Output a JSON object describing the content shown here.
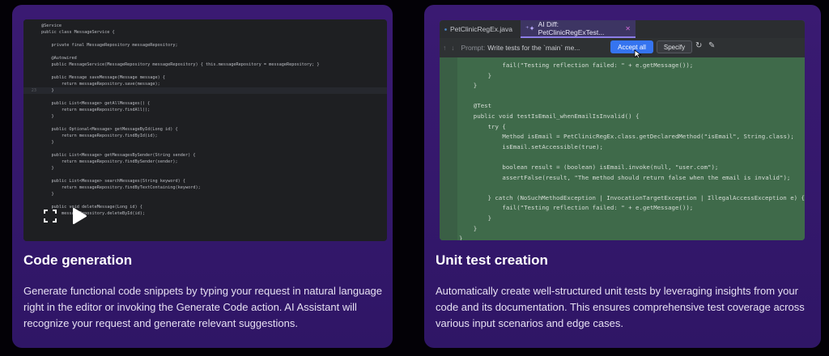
{
  "colors": {
    "background": "#030106",
    "card": "#351a6e",
    "accent": "#3574f0"
  },
  "left_card": {
    "title": "Code generation",
    "description": "Generate functional code snippets by typing your request in natural language right in the editor or invoking the Generate Code action. AI Assistant will recognize your request and generate relevant suggestions.",
    "code": [
      {
        "n": "",
        "t": "@Service"
      },
      {
        "n": "",
        "t": "public class MessageService {"
      },
      {
        "n": "",
        "t": ""
      },
      {
        "n": "",
        "t": "    private final MessageRepository messageRepository;"
      },
      {
        "n": "",
        "t": ""
      },
      {
        "n": "",
        "t": "    @Autowired"
      },
      {
        "n": "",
        "t": "    public MessageService(MessageRepository messageRepository) { this.messageRepository = messageRepository; }"
      },
      {
        "n": "",
        "t": ""
      },
      {
        "n": "",
        "t": "    public Message saveMessage(Message message) {"
      },
      {
        "n": "",
        "t": "        return messageRepository.save(message);"
      },
      {
        "n": "23",
        "t": "    }"
      },
      {
        "n": "",
        "t": ""
      },
      {
        "n": "",
        "t": "    public List<Message> getAllMessages() {"
      },
      {
        "n": "",
        "t": "        return messageRepository.findAll();"
      },
      {
        "n": "",
        "t": "    }"
      },
      {
        "n": "",
        "t": ""
      },
      {
        "n": "",
        "t": "    public Optional<Message> getMessageById(Long id) {"
      },
      {
        "n": "",
        "t": "        return messageRepository.findById(id);"
      },
      {
        "n": "",
        "t": "    }"
      },
      {
        "n": "",
        "t": ""
      },
      {
        "n": "",
        "t": "    public List<Message> getMessagesBySender(String sender) {"
      },
      {
        "n": "",
        "t": "        return messageRepository.findBySender(sender);"
      },
      {
        "n": "",
        "t": "    }"
      },
      {
        "n": "",
        "t": ""
      },
      {
        "n": "",
        "t": "    public List<Message> searchMessages(String keyword) {"
      },
      {
        "n": "",
        "t": "        return messageRepository.findByTextContaining(keyword);"
      },
      {
        "n": "",
        "t": "    }"
      },
      {
        "n": "",
        "t": ""
      },
      {
        "n": "",
        "t": "    public void deleteMessage(Long id) {"
      },
      {
        "n": "",
        "t": "        messageRepository.deleteById(id);"
      }
    ],
    "fullscreen_icon": "fullscreen-icon",
    "play_icon": "play-icon"
  },
  "right_card": {
    "title": "Unit test creation",
    "description": "Automatically create well-structured unit tests by leveraging insights from your code and its documentation. This ensures comprehensive test coverage across various input scenarios and edge cases.",
    "tabs": [
      {
        "label": "PetClinicRegEx.java"
      },
      {
        "label": "AI Diff: PetClinicRegExTest..."
      }
    ],
    "prompt_label": "Prompt:",
    "prompt_text": "Write tests for the `main` me...",
    "accept_label": "Accept all",
    "specify_label": "Specify",
    "code": [
      {
        "t": "            fail(\"Testing reflection failed: \" + e.getMessage());"
      },
      {
        "t": "        }"
      },
      {
        "t": "    }"
      },
      {
        "t": ""
      },
      {
        "t": "    @Test"
      },
      {
        "t": "    public void testIsEmail_whenEmailIsInvalid() {"
      },
      {
        "t": "        try {"
      },
      {
        "t": "            Method isEmail = PetClinicRegEx.class.getDeclaredMethod(\"isEmail\", String.class);"
      },
      {
        "t": "            isEmail.setAccessible(true);"
      },
      {
        "t": ""
      },
      {
        "t": "            boolean result = (boolean) isEmail.invoke(null, \"user.com\");"
      },
      {
        "t": "            assertFalse(result, \"The method should return false when the email is invalid\");"
      },
      {
        "t": ""
      },
      {
        "t": "        } catch (NoSuchMethodException | InvocationTargetException | IllegalAccessException e) {"
      },
      {
        "t": "            fail(\"Testing reflection failed: \" + e.getMessage());"
      },
      {
        "t": "        }"
      },
      {
        "t": "    }"
      },
      {
        "t": "}"
      }
    ]
  }
}
